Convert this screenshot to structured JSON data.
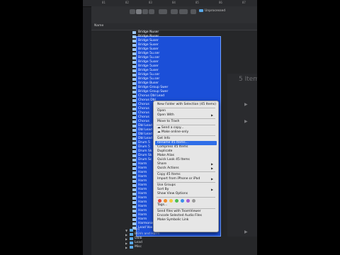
{
  "ruler": {
    "ticks": [
      "81",
      "82",
      "83",
      "84",
      "85",
      "86",
      "87"
    ]
  },
  "finder": {
    "path_label": "Unprocessed",
    "column_header": "Name"
  },
  "files": [
    "Bridge Nuser",
    "Bridge Nuser",
    "Bridge Suser",
    "Bridge Suser",
    "Bridge Suser",
    "Bridge 5u.ser",
    "Bridge 5u.ser",
    "Bridge 5user",
    "Bridge 5user",
    "Bridge 5user",
    "Bridge 5u.ser",
    "Bridge 5u.ser",
    "Bridge Buser",
    "Bridge Group Swer",
    "Bridge Group Swer",
    "Chorus Dbl Lead",
    "Chorus Dbl",
    "Chorus",
    "Chorus",
    "Chorus",
    "Chorus",
    "Chorus",
    "Dbl Lead",
    "Dbl Lead",
    "Dbl Lead",
    "Dbl Lead",
    "Drum 5",
    "Drum 5",
    "Drum Sk",
    "Drum Sk",
    "Drum Sc",
    "Harm",
    "Harm",
    "Harm",
    "Harm",
    "Harm",
    "Harm",
    "Harm",
    "Harm",
    "Harm",
    "Harm",
    "Harm",
    "Harm",
    "Harm",
    "Harm",
    "Harmonie",
    "Lead Vox"
  ],
  "below_rows": [
    {
      "label": "Brs",
      "expanded": true
    },
    {
      "label": "BGVs and Harm",
      "expanded": false
    },
    {
      "label": "Dblb",
      "expanded": false
    },
    {
      "label": "Lead",
      "expanded": false
    },
    {
      "label": "Misc",
      "expanded": false
    }
  ],
  "background_panel": {
    "text": "5 Items)"
  },
  "context_menu": {
    "items": [
      {
        "label": "New Folder with Selection (45 Items)",
        "submenu": false
      },
      {
        "sep": true
      },
      {
        "label": "Open",
        "submenu": false
      },
      {
        "label": "Open With",
        "submenu": true
      },
      {
        "sep": true
      },
      {
        "label": "Move to Trash",
        "submenu": false
      },
      {
        "sep": true
      },
      {
        "label": "☁ Send a copy...",
        "submenu": false
      },
      {
        "label": "☁ Make online-only",
        "submenu": false
      },
      {
        "sep": true
      },
      {
        "label": "Get Info",
        "submenu": false
      },
      {
        "label": "Rename 45 Items...",
        "submenu": false,
        "highlighted": true
      },
      {
        "label": "Compress 45 Items",
        "submenu": false
      },
      {
        "label": "Duplicate",
        "submenu": false
      },
      {
        "label": "Make Alias",
        "submenu": false
      },
      {
        "label": "Quick Look 45 Items",
        "submenu": false
      },
      {
        "label": "Share",
        "submenu": true
      },
      {
        "label": "Quick Actions",
        "submenu": true
      },
      {
        "sep": true
      },
      {
        "label": "Copy 45 Items",
        "submenu": false
      },
      {
        "label": "Import from iPhone or iPad",
        "submenu": true
      },
      {
        "sep": true
      },
      {
        "label": "Use Groups",
        "submenu": false
      },
      {
        "label": "Sort By",
        "submenu": true
      },
      {
        "label": "Show View Options",
        "submenu": false
      },
      {
        "sep": true
      },
      {
        "tags": true
      },
      {
        "label": "Tags...",
        "submenu": false
      },
      {
        "sep": true
      },
      {
        "label": "Send files with TeamViewer",
        "submenu": false
      },
      {
        "label": "Encode Selected Audio Files",
        "submenu": false
      },
      {
        "label": "Make Symbolic Link",
        "submenu": false
      }
    ],
    "tag_colors": [
      "#e64b3c",
      "#f08c2a",
      "#f1c940",
      "#4cbf4e",
      "#3b8eea",
      "#a35cd6",
      "#9b9b9b"
    ]
  }
}
